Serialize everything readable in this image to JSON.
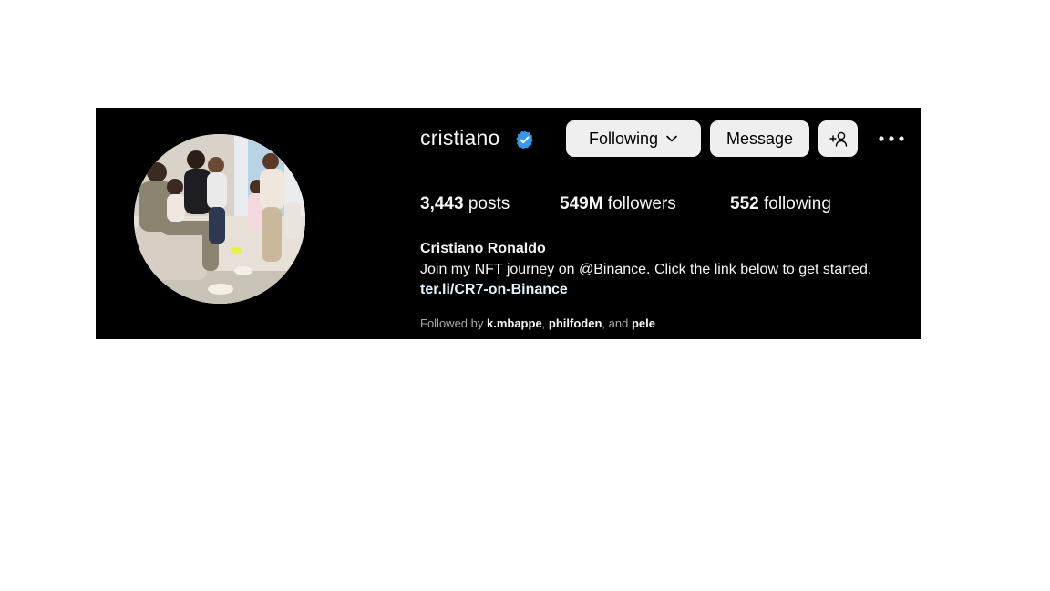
{
  "profile": {
    "username": "cristiano",
    "verified": true,
    "full_name": "Cristiano Ronaldo",
    "bio": "Join my NFT journey on @Binance. Click the link below to get started.",
    "link": "ter.li/CR7-on-Binance",
    "avatar_alt": "profile-photo"
  },
  "actions": {
    "following_label": "Following",
    "message_label": "Message"
  },
  "stats": {
    "posts_count": "3,443",
    "posts_label": " posts",
    "followers_count": "549M",
    "followers_label": " followers",
    "following_count": "552",
    "following_label": " following"
  },
  "followed_by": {
    "prefix": "Followed by ",
    "names": [
      "k.mbappe",
      "philfoden",
      "pele"
    ],
    "sep1": ", ",
    "sep2": ", and "
  },
  "colors": {
    "panel_bg": "#000000",
    "button_bg": "#efefef",
    "verified_blue": "#3897f0",
    "muted_text": "#a8a8a8"
  }
}
